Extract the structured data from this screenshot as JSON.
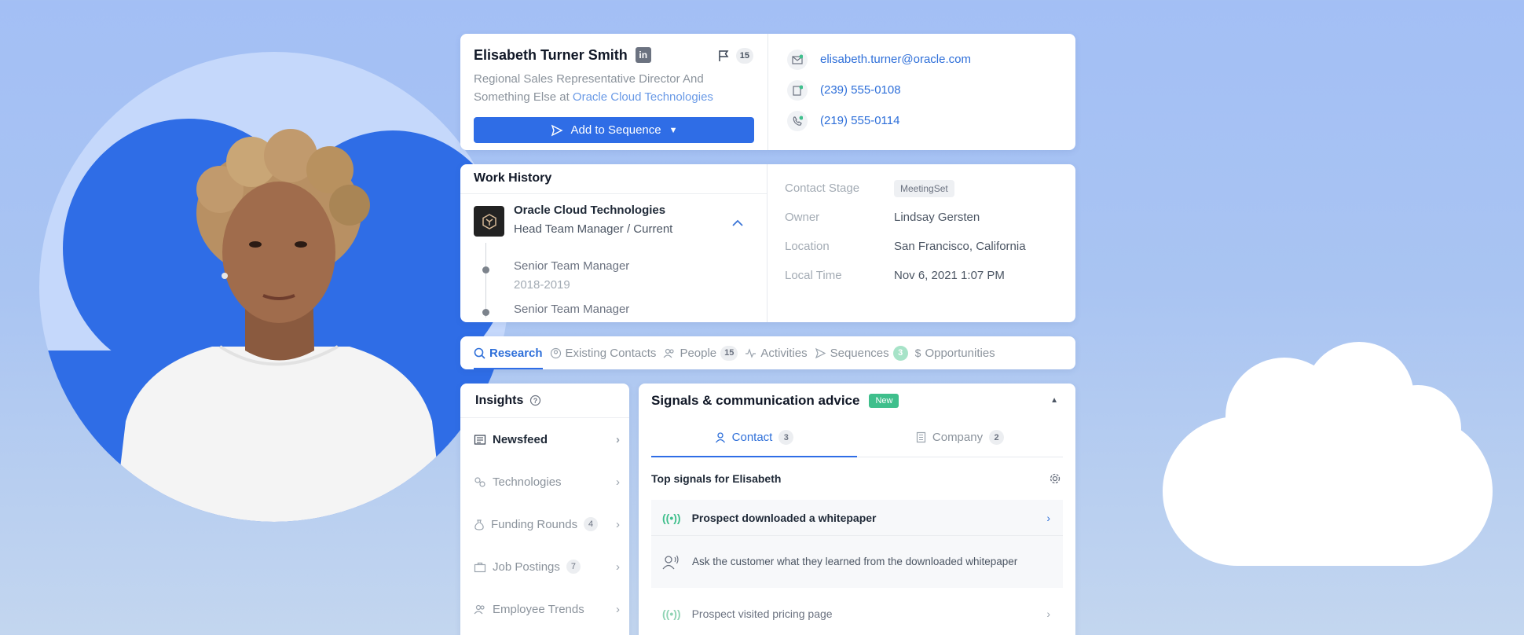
{
  "profile": {
    "name": "Elisabeth Turner Smith",
    "linkedin_icon": "in",
    "flag_count": "15",
    "headline": "Regional Sales Representative Director And Something Else at",
    "company_link": "Oracle Cloud Technologies",
    "add_to_sequence": "Add to Sequence",
    "email": "elisabeth.turner@oracle.com",
    "phone_direct": "(239) 555-0108",
    "phone_mobile": "(219) 555-0114"
  },
  "work_history": {
    "title": "Work History",
    "current": {
      "company": "Oracle Cloud Technologies",
      "role": "Head Team Manager / Current"
    },
    "previous": [
      {
        "role": "Senior Team Manager",
        "dates": "2018-2019"
      },
      {
        "role": "Senior Team Manager",
        "dates": ""
      }
    ]
  },
  "details": [
    {
      "label": "Contact Stage",
      "value": "MeetingSet",
      "pill": true
    },
    {
      "label": "Owner",
      "value": "Lindsay Gersten",
      "pill": false
    },
    {
      "label": "Location",
      "value": "San Francisco, California",
      "pill": false
    },
    {
      "label": "Local Time",
      "value": "Nov 6, 2021 1:07 PM",
      "pill": false
    }
  ],
  "tabs": [
    {
      "label": "Research",
      "badge": "",
      "icon": "search-icon",
      "active": true
    },
    {
      "label": "Existing Contacts",
      "badge": "",
      "icon": "contact-circle-icon",
      "active": false
    },
    {
      "label": "People",
      "badge": "15",
      "icon": "people-icon",
      "active": false
    },
    {
      "label": "Activities",
      "badge": "",
      "icon": "pulse-icon",
      "active": false
    },
    {
      "label": "Sequences",
      "badge": "3",
      "icon": "send-icon",
      "active": false
    },
    {
      "label": "Opportunities",
      "badge": "",
      "icon": "dollar-icon",
      "active": false
    }
  ],
  "insights": {
    "title": "Insights",
    "items": [
      {
        "label": "Newsfeed",
        "badge": "",
        "icon": "newspaper-icon",
        "active": true
      },
      {
        "label": "Technologies",
        "badge": "",
        "icon": "puzzle-icon",
        "active": false
      },
      {
        "label": "Funding Rounds",
        "badge": "4",
        "icon": "money-bag-icon",
        "active": false
      },
      {
        "label": "Job Postings",
        "badge": "7",
        "icon": "briefcase-icon",
        "active": false
      },
      {
        "label": "Employee Trends",
        "badge": "",
        "icon": "people-icon",
        "active": false
      }
    ]
  },
  "signals": {
    "title": "Signals & communication advice",
    "new_label": "New",
    "contact_tab": "Contact",
    "contact_count": "3",
    "company_tab": "Company",
    "company_count": "2",
    "top_signals": "Top signals for Elisabeth",
    "signal_1": "Prospect downloaded a whitepaper",
    "advice_1": "Ask the customer what they learned from the downloaded whitepaper",
    "signal_2": "Prospect visited pricing page"
  },
  "colors": {
    "accent": "#2f6de6",
    "link": "#2e6fd9",
    "signal_green": "#3fbf8c",
    "background": "#a3bff5"
  }
}
